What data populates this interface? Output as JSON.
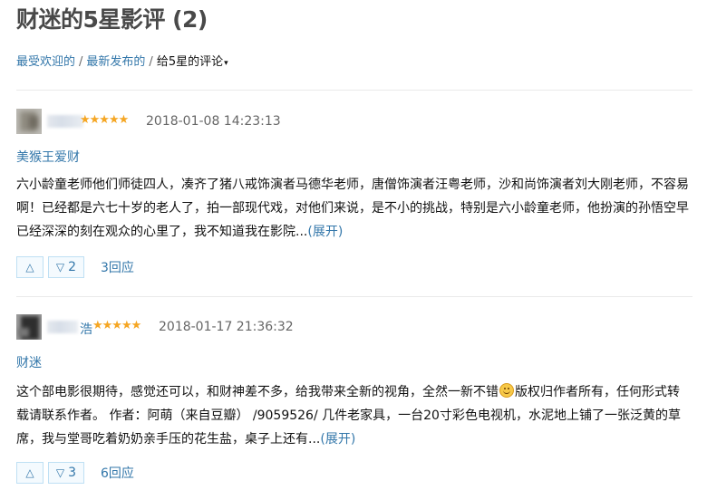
{
  "page": {
    "title": "财迷的5星影评 (2)"
  },
  "tabs": [
    {
      "label": "最受欢迎的"
    },
    {
      "label": "最新发布的"
    },
    {
      "label": "给5星的评论"
    }
  ],
  "tab_separator": "/",
  "caret_icon": "▾",
  "star_icon": "★★★★★",
  "up_icon": "△",
  "down_icon": "▽",
  "colors": {
    "link": "#3377aa",
    "star": "#f5a623",
    "title": "#494949"
  },
  "reviews": [
    {
      "rating": 5,
      "time": "2018-01-08 14:23:13",
      "title": "美猴王爱财",
      "body": "六小龄童老师他们师徒四人，凑齐了猪八戒饰演者马德华老师，唐僧饰演者汪粤老师，沙和尚饰演者刘大刚老师，不容易啊！已经都是六七十岁的老人了，拍一部现代戏，对他们来说，是不小的挑战，特别是六小龄童老师，他扮演的孙悟空早已经深深的刻在观众的心里了，我不知道我在影院...",
      "expand": "(展开)",
      "useless_count": "2",
      "replies": "3回应"
    },
    {
      "rating": 5,
      "name_suffix": "浩",
      "time": "2018-01-17 21:36:32",
      "title": "财迷",
      "body_a": "这个部电影很期待，感觉还可以，和财神差不多，给我带来全新的视角，全然一新不错",
      "body_b": "版权归作者所有，任何形式转载请联系作者。 作者：阿萌（来自豆瓣） /9059526/ 几件老家具，一台20寸彩色电视机，水泥地上铺了一张泛黄的草席，我与堂哥吃着奶奶亲手压的花生盐，桌子上还有...",
      "expand": "(展开)",
      "useless_count": "3",
      "replies": "6回应"
    }
  ]
}
